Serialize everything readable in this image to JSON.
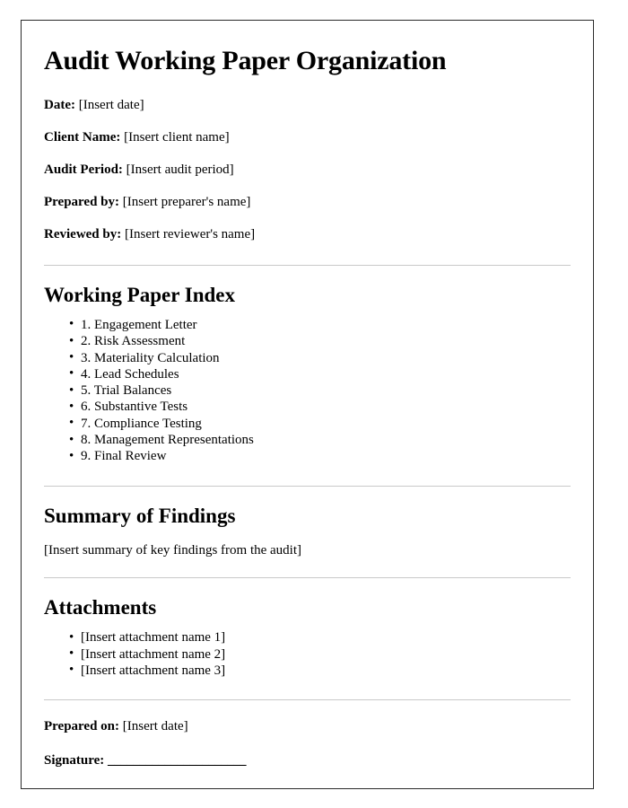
{
  "document": {
    "title": "Audit Working Paper Organization",
    "header_fields": [
      {
        "label": "Date:",
        "value": "[Insert date]"
      },
      {
        "label": "Client Name:",
        "value": "[Insert client name]"
      },
      {
        "label": "Audit Period:",
        "value": "[Insert audit period]"
      },
      {
        "label": "Prepared by:",
        "value": "[Insert preparer's name]"
      },
      {
        "label": "Reviewed by:",
        "value": "[Insert reviewer's name]"
      }
    ],
    "sections": {
      "working_paper_index": {
        "heading": "Working Paper Index",
        "items": [
          "1. Engagement Letter",
          "2. Risk Assessment",
          "3. Materiality Calculation",
          "4. Lead Schedules",
          "5. Trial Balances",
          "6. Substantive Tests",
          "7. Compliance Testing",
          "8. Management Representations",
          "9. Final Review"
        ]
      },
      "summary_of_findings": {
        "heading": "Summary of Findings",
        "body": "[Insert summary of key findings from the audit]"
      },
      "attachments": {
        "heading": "Attachments",
        "items": [
          "[Insert attachment name 1]",
          "[Insert attachment name 2]",
          "[Insert attachment name 3]"
        ]
      }
    },
    "footer": {
      "prepared_on_label": "Prepared on:",
      "prepared_on_value": "[Insert date]",
      "signature_label": "Signature:",
      "signature_line": "______________________"
    },
    "colors": {
      "text": "#000000",
      "page_border": "#2b2b2b",
      "rule": "#c9c9c9",
      "background": "#ffffff"
    }
  }
}
